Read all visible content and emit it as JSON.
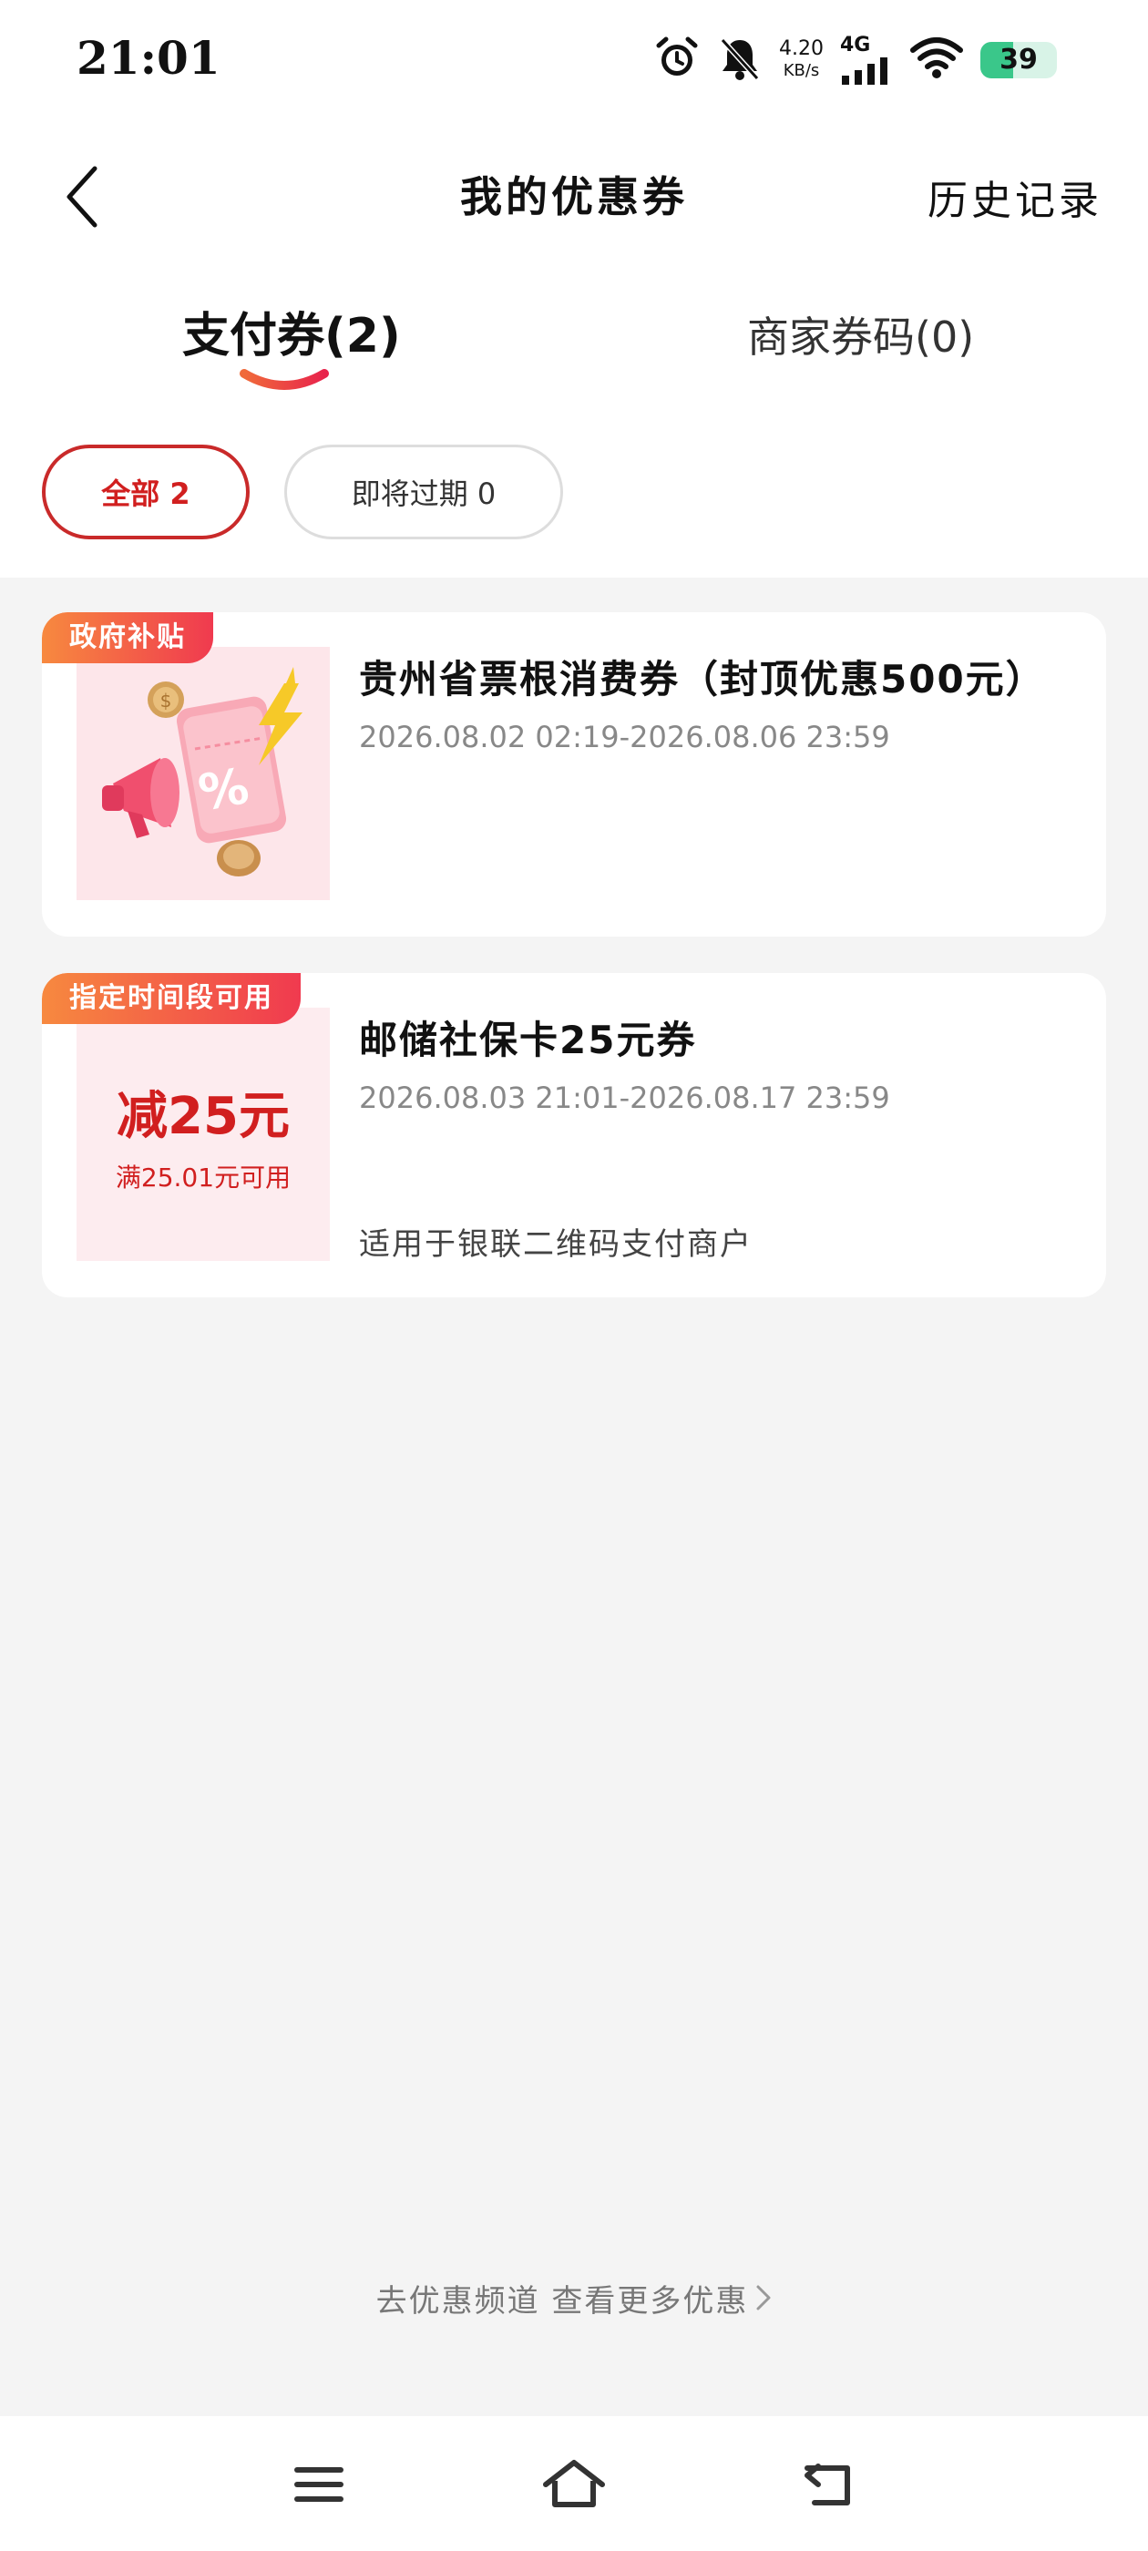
{
  "status_bar": {
    "time": "21:01",
    "net_speed_value": "4.20",
    "net_speed_unit": "KB/s",
    "network_type": "4G",
    "battery": "39",
    "icons": [
      "alarm-icon",
      "bell-off-icon",
      "signal-icon",
      "wifi-icon",
      "battery-icon"
    ]
  },
  "header": {
    "title": "我的优惠券",
    "history_label": "历史记录",
    "back_icon": "chevron-left-icon"
  },
  "tabs": [
    {
      "label": "支付券(2)",
      "active": true
    },
    {
      "label": "商家券码(0)",
      "active": false
    }
  ],
  "filters": [
    {
      "label": "全部 2",
      "active": true
    },
    {
      "label": "即将过期 0",
      "active": false
    }
  ],
  "coupons": [
    {
      "tag": "政府补贴",
      "title": "贵州省票根消费券（封顶优惠500元）",
      "date": "2026.08.02 02:19-2026.08.06 23:59",
      "thumb_icon": "coupon-megaphone-icon"
    },
    {
      "tag": "指定时间段可用",
      "title": "邮储社保卡25元券",
      "date": "2026.08.03 21:01-2026.08.17 23:59",
      "amount": "减25元",
      "condition": "满25.01元可用",
      "note": "适用于银联二维码支付商户"
    }
  ],
  "footer": {
    "more_link": "去优惠频道 查看更多优惠"
  },
  "nav_bar": {
    "icons": [
      "menu-icon",
      "home-icon",
      "back-icon"
    ]
  },
  "colors": {
    "accent": "#d11f1f",
    "tag_gradient_start": "#f7893f",
    "tag_gradient_end": "#f03a4f",
    "background": "#f4f4f4"
  }
}
